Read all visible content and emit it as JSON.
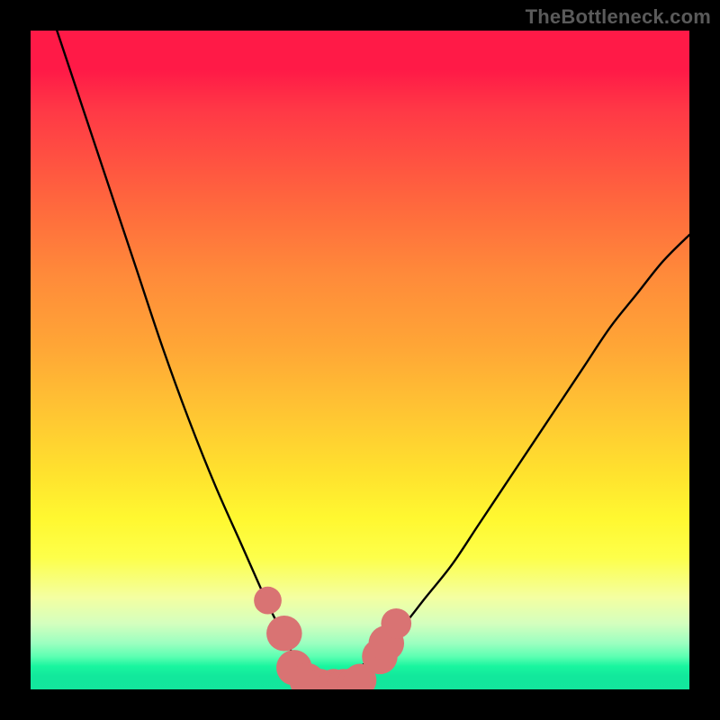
{
  "watermark": "TheBottleneck.com",
  "colors": {
    "background": "#000000",
    "curve": "#000000",
    "marker_fill": "#d97373",
    "marker_stroke": "#c95f5f",
    "gradient_top": "#ff1a47",
    "gradient_bottom": "#13e69d"
  },
  "chart_data": {
    "type": "line",
    "title": "",
    "xlabel": "",
    "ylabel": "",
    "xlim": [
      0,
      100
    ],
    "ylim": [
      0,
      100
    ],
    "series": [
      {
        "name": "left-curve",
        "x": [
          4,
          8,
          12,
          16,
          20,
          24,
          28,
          32,
          36,
          38,
          40,
          42,
          44
        ],
        "values": [
          100,
          88,
          76,
          64,
          52,
          41,
          31,
          22,
          13,
          9,
          5,
          2,
          0
        ]
      },
      {
        "name": "right-curve",
        "x": [
          44,
          48,
          52,
          56,
          60,
          64,
          68,
          72,
          76,
          80,
          84,
          88,
          92,
          96,
          100
        ],
        "values": [
          0,
          2,
          5,
          9,
          14,
          19,
          25,
          31,
          37,
          43,
          49,
          55,
          60,
          65,
          69
        ]
      }
    ],
    "markers": {
      "name": "bottom-markers",
      "x": [
        36,
        38.5,
        40,
        42,
        44,
        46,
        47.5,
        49,
        50,
        53,
        54,
        55.5
      ],
      "y": [
        13.5,
        8.5,
        3.3,
        1.3,
        0.6,
        0.6,
        0.6,
        0.8,
        1.4,
        5.0,
        7.0,
        10.0
      ],
      "r": [
        2.1,
        2.7,
        2.7,
        2.7,
        2.5,
        2.5,
        2.5,
        2.5,
        2.5,
        2.7,
        2.7,
        2.3
      ]
    }
  }
}
